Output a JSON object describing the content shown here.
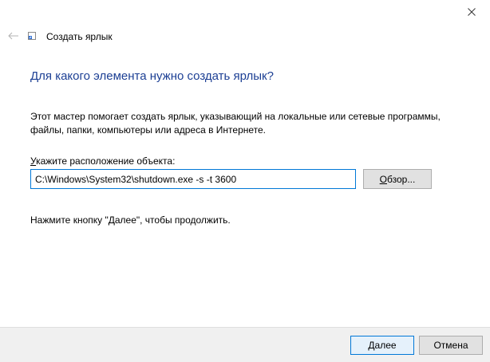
{
  "window": {
    "title": "Создать ярлык",
    "icons": {
      "close": "close-icon",
      "back": "back-arrow-icon",
      "title": "shortcut-icon"
    }
  },
  "content": {
    "heading": "Для какого элемента нужно создать ярлык?",
    "description": "Этот мастер помогает создать ярлык, указывающий на локальные или сетевые программы, файлы, папки, компьютеры или адреса в Интернете.",
    "location_label_accel": "У",
    "location_label_rest": "кажите расположение объекта:",
    "location_value": "C:\\Windows\\System32\\shutdown.exe -s -t 3600",
    "browse_accel": "О",
    "browse_rest": "бзор...",
    "hint": "Нажмите кнопку \"Далее\", чтобы продолжить."
  },
  "footer": {
    "next_accel": "Д",
    "next_rest": "алее",
    "cancel_label": "Отмена"
  },
  "colors": {
    "heading": "#1c3f94",
    "accent": "#0078d7",
    "footer_bg": "#f0f0f0"
  }
}
